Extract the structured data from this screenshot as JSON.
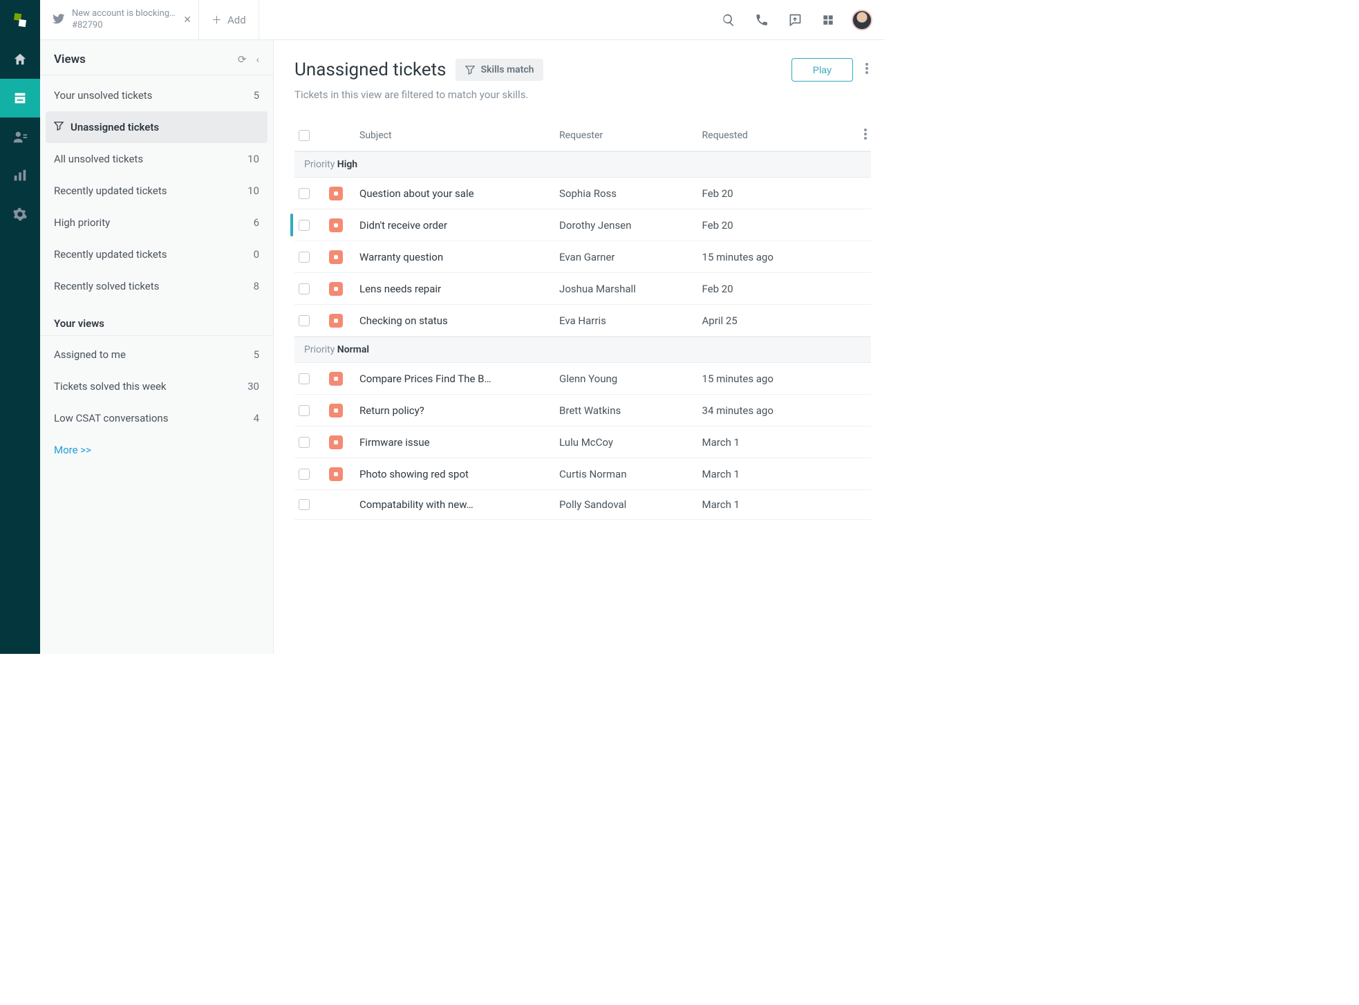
{
  "topbar": {
    "tab_title": "New account is blocking…",
    "tab_subtitle": "#82790",
    "add_label": "Add"
  },
  "sidebar": {
    "heading": "Views",
    "system": [
      {
        "label": "Your unsolved tickets",
        "count": "5"
      },
      {
        "label": "Unassigned tickets",
        "count": ""
      },
      {
        "label": "All unsolved tickets",
        "count": "10"
      },
      {
        "label": "Recently updated tickets",
        "count": "10"
      },
      {
        "label": "High priority",
        "count": "6"
      },
      {
        "label": "Recently updated tickets",
        "count": "0"
      },
      {
        "label": "Recently solved tickets",
        "count": "8"
      }
    ],
    "your_views_label": "Your views",
    "your": [
      {
        "label": "Assigned to me",
        "count": "5"
      },
      {
        "label": "Tickets solved this week",
        "count": "30"
      },
      {
        "label": "Low CSAT conversations",
        "count": "4"
      }
    ],
    "more_label": "More >>"
  },
  "main": {
    "title": "Unassigned tickets",
    "skills_match": "Skills match",
    "subtitle": "Tickets in this view are filtered to match your skills.",
    "play_label": "Play",
    "columns": {
      "subject": "Subject",
      "requester": "Requester",
      "requested": "Requested"
    },
    "group_prefix": "Priority",
    "groups": [
      {
        "priority": "High",
        "rows": [
          {
            "subject": "Question about your sale",
            "requester": "Sophia Ross",
            "requested": "Feb 20",
            "status": true,
            "accent": false
          },
          {
            "subject": "Didn't receive order",
            "requester": "Dorothy Jensen",
            "requested": "Feb 20",
            "status": true,
            "accent": true
          },
          {
            "subject": "Warranty question",
            "requester": "Evan Garner",
            "requested": "15 minutes ago",
            "status": true,
            "accent": false
          },
          {
            "subject": "Lens needs repair",
            "requester": "Joshua Marshall",
            "requested": "Feb 20",
            "status": true,
            "accent": false
          },
          {
            "subject": "Checking on status",
            "requester": "Eva Harris",
            "requested": "April 25",
            "status": true,
            "accent": false
          }
        ]
      },
      {
        "priority": "Normal",
        "rows": [
          {
            "subject": "Compare Prices Find The B…",
            "requester": "Glenn Young",
            "requested": "15 minutes ago",
            "status": true,
            "accent": false
          },
          {
            "subject": "Return policy?",
            "requester": "Brett Watkins",
            "requested": "34 minutes ago",
            "status": true,
            "accent": false
          },
          {
            "subject": "Firmware issue",
            "requester": "Lulu McCoy",
            "requested": "March 1",
            "status": true,
            "accent": false
          },
          {
            "subject": "Photo showing red spot",
            "requester": "Curtis Norman",
            "requested": "March 1",
            "status": true,
            "accent": false
          },
          {
            "subject": "Compatability with new…",
            "requester": "Polly Sandoval",
            "requested": "March 1",
            "status": false,
            "accent": false
          }
        ]
      }
    ]
  }
}
